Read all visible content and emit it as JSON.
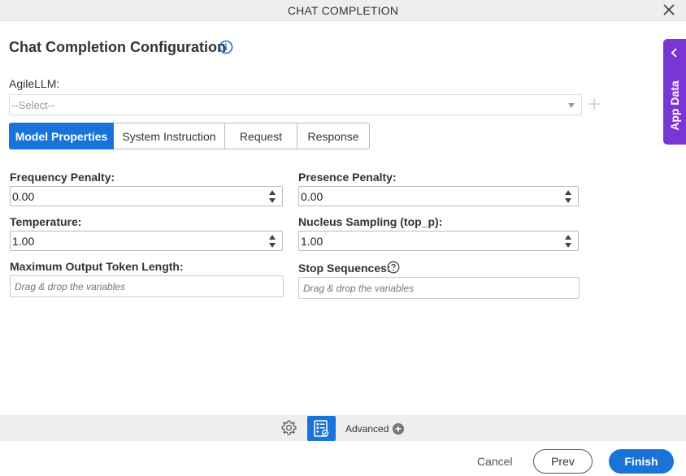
{
  "window": {
    "title": "CHAT COMPLETION",
    "close_icon": "close-icon"
  },
  "header": {
    "title": "Chat Completion Configuration",
    "info_icon": "info-icon"
  },
  "side_panel": {
    "label": "App Data",
    "icon": "chevron-left-icon",
    "color": "#7b35d3"
  },
  "agile_llm": {
    "label": "AgileLLM:",
    "selected": "--Select--",
    "add_icon": "plus-icon"
  },
  "tabs": [
    {
      "label": "Model Properties",
      "active": true
    },
    {
      "label": "System Instruction",
      "active": false
    },
    {
      "label": "Request",
      "active": false
    },
    {
      "label": "Response",
      "active": false
    }
  ],
  "fields": {
    "frequency_penalty": {
      "label": "Frequency Penalty:",
      "value": "0.00"
    },
    "presence_penalty": {
      "label": "Presence Penalty:",
      "value": "0.00"
    },
    "temperature": {
      "label": "Temperature:",
      "value": "1.00"
    },
    "top_p": {
      "label": "Nucleus Sampling (top_p):",
      "value": "1.00"
    },
    "max_tokens": {
      "label": "Maximum Output Token Length:",
      "placeholder": "Drag & drop the variables"
    },
    "stop_sequences": {
      "label": "Stop Sequences:",
      "placeholder": "Drag & drop the variables",
      "help_icon": "help-icon"
    }
  },
  "footer": {
    "advanced_label": "Advanced",
    "cancel": "Cancel",
    "prev": "Prev",
    "finish": "Finish"
  },
  "colors": {
    "accent": "#1a73d9",
    "side_panel": "#7b35d3",
    "bar": "#eeeeee"
  }
}
